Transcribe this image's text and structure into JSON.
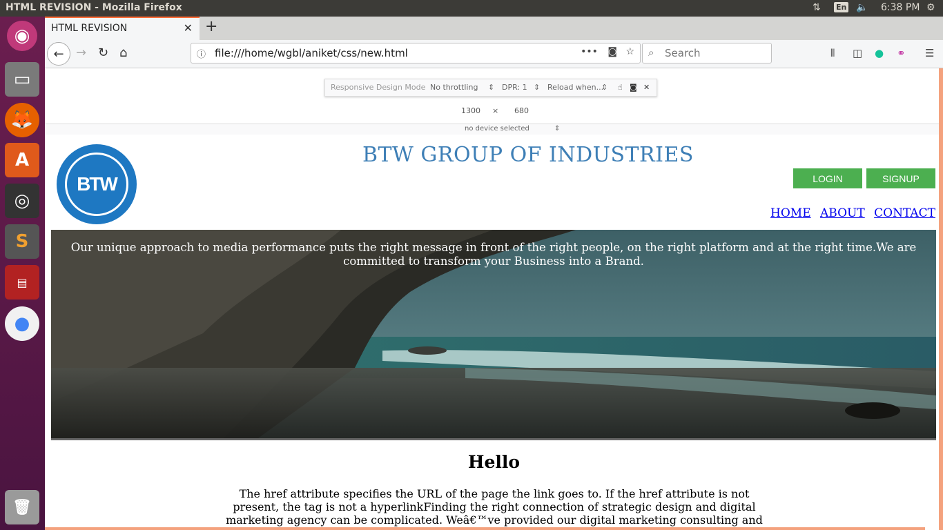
{
  "system": {
    "window_title": "HTML REVISION - Mozilla Firefox",
    "keyboard_layout": "En",
    "clock": "6:38 PM"
  },
  "launcher": {
    "items": [
      {
        "name": "ubuntu-dash-icon",
        "color": "#c0397a"
      },
      {
        "name": "files-icon",
        "color": "#7a7a7a"
      },
      {
        "name": "firefox-icon",
        "color": "#e66000"
      },
      {
        "name": "software-center-icon",
        "color": "#e05a1b"
      },
      {
        "name": "vault-icon",
        "color": "#333333"
      },
      {
        "name": "sublime-text-icon",
        "color": "#555555"
      },
      {
        "name": "terminal-multiplexer-icon",
        "color": "#b22222"
      },
      {
        "name": "chrome-icon",
        "color": "#4285f4"
      },
      {
        "name": "trash-icon",
        "color": "#9a9a9a"
      }
    ]
  },
  "browser": {
    "tab_title": "HTML REVISION",
    "url": "file:///home/wgbl/aniket/css/new.html",
    "search_placeholder": "Search",
    "accent_color": "#ff6c37"
  },
  "rdm": {
    "mode_label": "Responsive Design Mode",
    "throttling": "No throttling",
    "dpr": "DPR: 1",
    "reload": "Reload when...",
    "width": "1300",
    "times": "×",
    "height": "680",
    "device": "no device selected"
  },
  "page": {
    "company": "BTW GROUP OF INDUSTRIES",
    "logo_text": "BTW",
    "login_label": "LOGIN",
    "signup_label": "SIGNUP",
    "nav": {
      "home": "HOME",
      "about": "ABOUT",
      "contact": "CONTACT"
    },
    "hero_text": "Our unique approach to media performance puts the right message in front of the right people, on the right platform and at the right time.We are committed to transform your Business into a Brand.",
    "heading": "Hello",
    "paragraph": "The href attribute specifies the URL of the page the link goes to. If the href attribute is not present, the tag is not a hyperlinkFinding the right connection of strategic design and digital marketing agency can be complicated. Weâ€™ve provided our digital marketing consulting and",
    "brand_color": "#3e7fb6",
    "button_color": "#4caf50"
  }
}
